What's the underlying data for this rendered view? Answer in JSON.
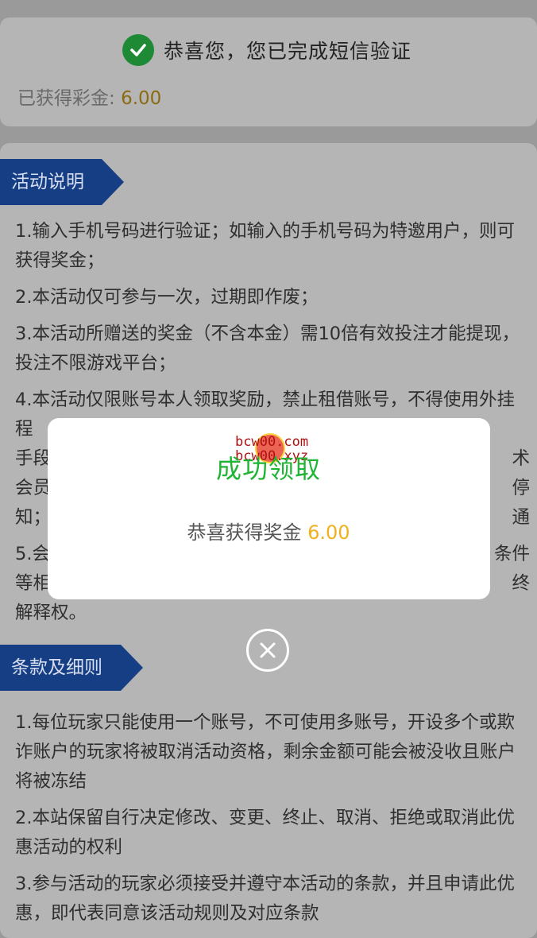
{
  "verification": {
    "message": "恭喜您，您已完成短信验证",
    "earned_label": "已获得彩金: ",
    "earned_amount": "6.00"
  },
  "activity": {
    "heading": "活动说明",
    "rules": [
      "1.输入手机号码进行验证；如输入的手机号码为特邀用户，则可获得奖金；",
      "2.本活动仅可参与一次，过期即作废；",
      "3.本活动所赠送的奖金（不含本金）需10倍有效投注才能提现，投注不限游戏平台；",
      "4.本活动仅限账号本人领取奖励，禁止租借账号，不得使用外挂程",
      "术",
      "手段",
      "停",
      "会员",
      "通",
      "知；",
      "5.会",
      "条件",
      "等相",
      "终",
      "解释权。"
    ]
  },
  "terms": {
    "heading": "条款及细则",
    "items": [
      "1.每位玩家只能使用一个账号，不可使用多账号，开设多个或欺诈账户的玩家将被取消活动资格，剩余金额可能会被没收且账户将被冻结",
      "2.本站保留自行决定修改、变更、终止、取消、拒绝或取消此优惠活动的权利",
      "3.参与活动的玩家必须接受并遵守本活动的条款，并且申请此优惠，即代表同意该活动规则及对应条款"
    ]
  },
  "modal": {
    "title": "成功领取",
    "message_prefix": "恭喜获得奖金 ",
    "amount": "6.00",
    "watermark_line1": "bcw00.com",
    "watermark_line2": "bcw00.xyz"
  },
  "colors": {
    "ribbon": "#163e85",
    "success_green": "#20b434",
    "amount_gold": "#f0b11c"
  },
  "icons": {
    "verify": "check-circle-icon",
    "close": "close-circle-icon"
  }
}
